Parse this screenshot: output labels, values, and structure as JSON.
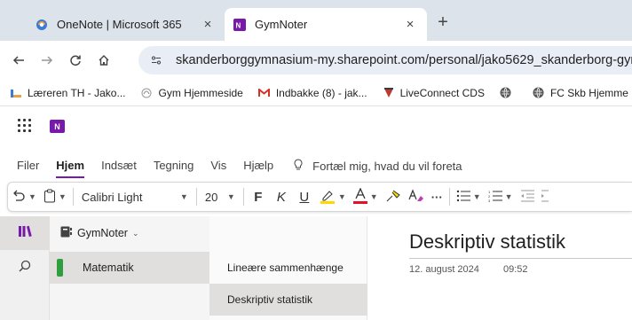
{
  "browser": {
    "tabs": [
      {
        "title": "OneNote | Microsoft 365",
        "icon": "microsoft-365-icon",
        "active": false
      },
      {
        "title": "GymNoter",
        "icon": "onenote-icon",
        "active": true
      }
    ],
    "close_glyph": "×",
    "new_tab_glyph": "+",
    "url": "skanderborggymnasium-my.sharepoint.com/personal/jako5629_skanderborg-gym",
    "bookmarks": [
      {
        "label": "Læreren TH - Jako...",
        "icon": "bookmark-favicon"
      },
      {
        "label": "Gym Hjemmeside",
        "icon": "gym-favicon"
      },
      {
        "label": "Indbakke (8) - jak...",
        "icon": "gmail-icon"
      },
      {
        "label": "LiveConnect CDS",
        "icon": "liveconnect-icon"
      },
      {
        "label": "",
        "icon": "globe-icon"
      },
      {
        "label": "FC Skb Hjemme",
        "icon": "globe-icon"
      }
    ]
  },
  "ribbon": {
    "tabs": [
      "Filer",
      "Hjem",
      "Indsæt",
      "Tegning",
      "Vis",
      "Hjælp"
    ],
    "active_tab": "Hjem",
    "tell_me": "Fortæl mig, hvad du vil foreta",
    "font_name": "Calibri Light",
    "font_size": "20",
    "bold": "F",
    "italic": "K",
    "underline": "U",
    "more": "···"
  },
  "notebook": {
    "name": "GymNoter",
    "section": "Matematik",
    "section_color": "#2e9e3f",
    "pages": [
      "Lineære sammenhænge",
      "Deskriptiv statistik"
    ],
    "selected_page": "Deskriptiv statistik"
  },
  "page": {
    "title": "Deskriptiv statistik",
    "date": "12. august 2024",
    "time": "09:52"
  },
  "colors": {
    "accent": "#7719aa",
    "tab_strip": "#dde3ea",
    "highlight": "#ffd800",
    "font_color": "#e81123"
  }
}
